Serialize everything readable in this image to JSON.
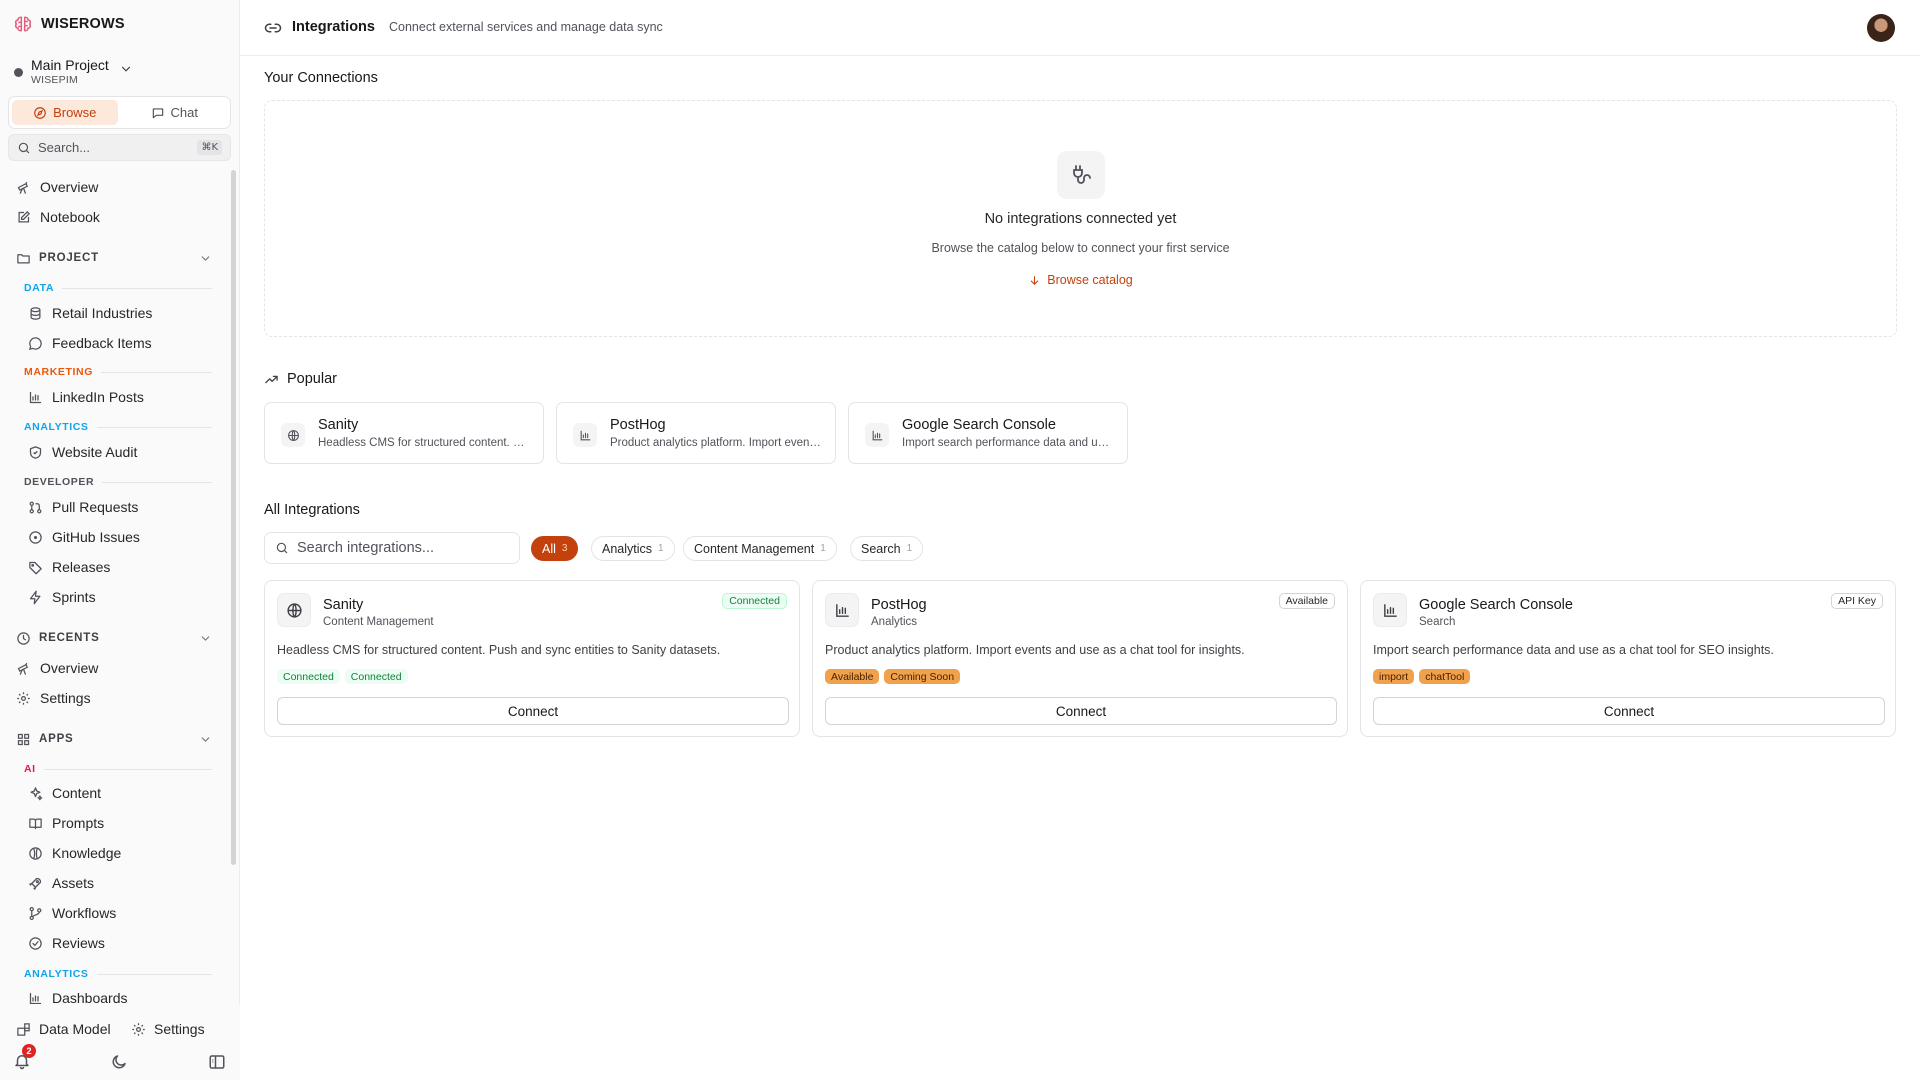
{
  "brand": {
    "name": "WISEROWS"
  },
  "project": {
    "name": "Main Project",
    "sub": "WISEPIM"
  },
  "modes": {
    "browse": "Browse",
    "chat": "Chat"
  },
  "sidebar_search": {
    "placeholder": "Search...",
    "shortcut": "⌘K"
  },
  "nav": {
    "overview": "Overview",
    "notebook": "Notebook",
    "project_section": "PROJECT",
    "groups": {
      "data": "DATA",
      "marketing": "MARKETING",
      "analytics": "ANALYTICS",
      "developer": "DEVELOPER",
      "ai": "AI",
      "analytics2": "ANALYTICS"
    },
    "items": {
      "retail_industries": "Retail Industries",
      "feedback_items": "Feedback Items",
      "linkedin_posts": "LinkedIn Posts",
      "website_audit": "Website Audit",
      "pull_requests": "Pull Requests",
      "github_issues": "GitHub Issues",
      "releases": "Releases",
      "sprints": "Sprints"
    },
    "recents_section": "RECENTS",
    "recents": {
      "overview": "Overview",
      "settings": "Settings"
    },
    "apps_section": "APPS",
    "apps": {
      "content": "Content",
      "prompts": "Prompts",
      "knowledge": "Knowledge",
      "assets": "Assets",
      "workflows": "Workflows",
      "reviews": "Reviews",
      "dashboards": "Dashboards"
    }
  },
  "sidebar_bottom": {
    "data_model": "Data Model",
    "settings": "Settings",
    "notifications_count": "2"
  },
  "header": {
    "title": "Integrations",
    "subtitle": "Connect external services and manage data sync"
  },
  "connections": {
    "heading": "Your Connections",
    "empty_title": "No integrations connected yet",
    "empty_sub": "Browse the catalog below to connect your first service",
    "browse_link": "Browse catalog"
  },
  "popular": {
    "heading": "Popular",
    "items": [
      {
        "name": "Sanity",
        "desc": "Headless CMS for structured content. Push and sync entities to Sanity datasets."
      },
      {
        "name": "PostHog",
        "desc": "Product analytics platform. Import events and use as a chat tool for insights."
      },
      {
        "name": "Google Search Console",
        "desc": "Import search performance data and use as a chat tool for SEO insights."
      }
    ]
  },
  "all": {
    "heading": "All Integrations",
    "search_placeholder": "Search integrations...",
    "filters": [
      {
        "label": "All",
        "count": "3"
      },
      {
        "label": "Analytics",
        "count": "1"
      },
      {
        "label": "Content Management",
        "count": "1"
      },
      {
        "label": "Search",
        "count": "1"
      }
    ],
    "cards": [
      {
        "name": "Sanity",
        "category": "Content Management",
        "status": "Connected",
        "desc": "Headless CMS for structured content. Push and sync entities to Sanity datasets.",
        "tags": [
          "Connected",
          "Connected"
        ],
        "button": "Connect"
      },
      {
        "name": "PostHog",
        "category": "Analytics",
        "status": "Available",
        "desc": "Product analytics platform. Import events and use as a chat tool for insights.",
        "tags": [
          "Available",
          "Coming Soon"
        ],
        "button": "Connect"
      },
      {
        "name": "Google Search Console",
        "category": "Search",
        "status": "API Key",
        "desc": "Import search performance data and use as a chat tool for SEO insights.",
        "tags": [
          "import",
          "chatTool"
        ],
        "button": "Connect"
      }
    ]
  },
  "colors": {
    "accent": "#c2410c",
    "accent_soft": "#fde8dc",
    "tag_orange": "#f0a14b",
    "connected_green": "#15803d"
  }
}
